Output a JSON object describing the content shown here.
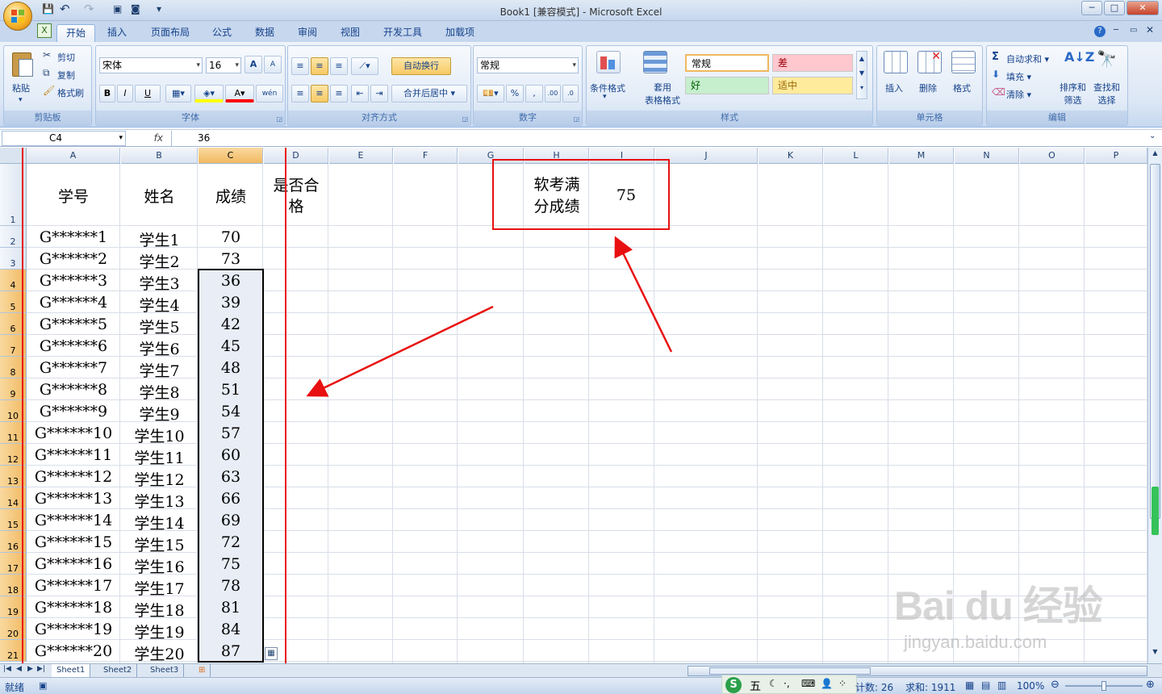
{
  "app": {
    "title": "Book1  [兼容模式] - Microsoft Excel",
    "window_buttons": {
      "minimize": "─",
      "maximize": "□",
      "close": "✕"
    }
  },
  "qat": {
    "save": "💾",
    "undo": "↶",
    "redo": "↷",
    "customize": "▾"
  },
  "tabs": [
    "开始",
    "插入",
    "页面布局",
    "公式",
    "数据",
    "审阅",
    "视图",
    "开发工具",
    "加载项"
  ],
  "active_tab": "开始",
  "ribbon": {
    "clipboard": {
      "label": "剪贴板",
      "paste": "粘贴",
      "cut": "剪切",
      "copy": "复制",
      "format_painter": "格式刷"
    },
    "font": {
      "label": "字体",
      "name": "宋体",
      "size": "16",
      "bold": "B",
      "italic": "I",
      "underline": "U",
      "grow": "A",
      "shrink": "A",
      "phonetic": "wén"
    },
    "alignment": {
      "label": "对齐方式",
      "wrap": "自动换行",
      "merge": "合并后居中"
    },
    "number": {
      "label": "数字",
      "format": "常规",
      "percent": "%",
      "comma": ","
    },
    "styles": {
      "label": "样式",
      "conditional": "条件格式",
      "table": "套用\n表格格式",
      "normal": "常规",
      "bad": "差",
      "good": "好",
      "neutral": "适中"
    },
    "cells": {
      "label": "单元格",
      "insert": "插入",
      "delete": "删除",
      "format": "格式"
    },
    "editing": {
      "label": "编辑",
      "autosum": "自动求和",
      "fill": "填充",
      "clear": "清除",
      "sort": "排序和\n筛选",
      "find": "查找和\n选择"
    }
  },
  "formula_bar": {
    "name_box": "C4",
    "fx": "fx",
    "content": "36"
  },
  "columns": [
    "A",
    "B",
    "C",
    "D",
    "E",
    "F",
    "G",
    "H",
    "I",
    "J",
    "K",
    "L",
    "M",
    "N",
    "O",
    "P"
  ],
  "sheet": {
    "headers": {
      "A": "学号",
      "B": "姓名",
      "C": "成绩",
      "D": "是否合格"
    },
    "rows": [
      {
        "row": "2",
        "id": "G******1",
        "name": "学生1",
        "score": "70"
      },
      {
        "row": "3",
        "id": "G******2",
        "name": "学生2",
        "score": "73"
      },
      {
        "row": "4",
        "id": "G******3",
        "name": "学生3",
        "score": "36"
      },
      {
        "row": "5",
        "id": "G******4",
        "name": "学生4",
        "score": "39"
      },
      {
        "row": "6",
        "id": "G******5",
        "name": "学生5",
        "score": "42"
      },
      {
        "row": "7",
        "id": "G******6",
        "name": "学生6",
        "score": "45"
      },
      {
        "row": "8",
        "id": "G******7",
        "name": "学生7",
        "score": "48"
      },
      {
        "row": "9",
        "id": "G******8",
        "name": "学生8",
        "score": "51"
      },
      {
        "row": "10",
        "id": "G******9",
        "name": "学生9",
        "score": "54"
      },
      {
        "row": "11",
        "id": "G******10",
        "name": "学生10",
        "score": "57"
      },
      {
        "row": "12",
        "id": "G******11",
        "name": "学生11",
        "score": "60"
      },
      {
        "row": "13",
        "id": "G******12",
        "name": "学生12",
        "score": "63"
      },
      {
        "row": "14",
        "id": "G******13",
        "name": "学生13",
        "score": "66"
      },
      {
        "row": "15",
        "id": "G******14",
        "name": "学生14",
        "score": "69"
      },
      {
        "row": "16",
        "id": "G******15",
        "name": "学生15",
        "score": "72"
      },
      {
        "row": "17",
        "id": "G******16",
        "name": "学生16",
        "score": "75"
      },
      {
        "row": "18",
        "id": "G******17",
        "name": "学生17",
        "score": "78"
      },
      {
        "row": "19",
        "id": "G******18",
        "name": "学生18",
        "score": "81"
      },
      {
        "row": "20",
        "id": "G******19",
        "name": "学生19",
        "score": "84"
      },
      {
        "row": "21",
        "id": "G******20",
        "name": "学生20",
        "score": "87"
      }
    ],
    "header_row": "1",
    "ref_label": "软考满分成绩",
    "ref_value": "75"
  },
  "sheet_tabs": [
    "Sheet1",
    "Sheet2",
    "Sheet3"
  ],
  "status": {
    "ready": "就绪",
    "count": "计数: 26",
    "sum": "求和: 1911",
    "zoom": "100%",
    "ime": "五"
  },
  "watermark": {
    "brand": "Bai du 经验",
    "url": "jingyan.baidu.com"
  },
  "colors": {
    "annotation": "#e81010",
    "selection": "#e8edf6",
    "header_selected": "#f5c77e"
  }
}
